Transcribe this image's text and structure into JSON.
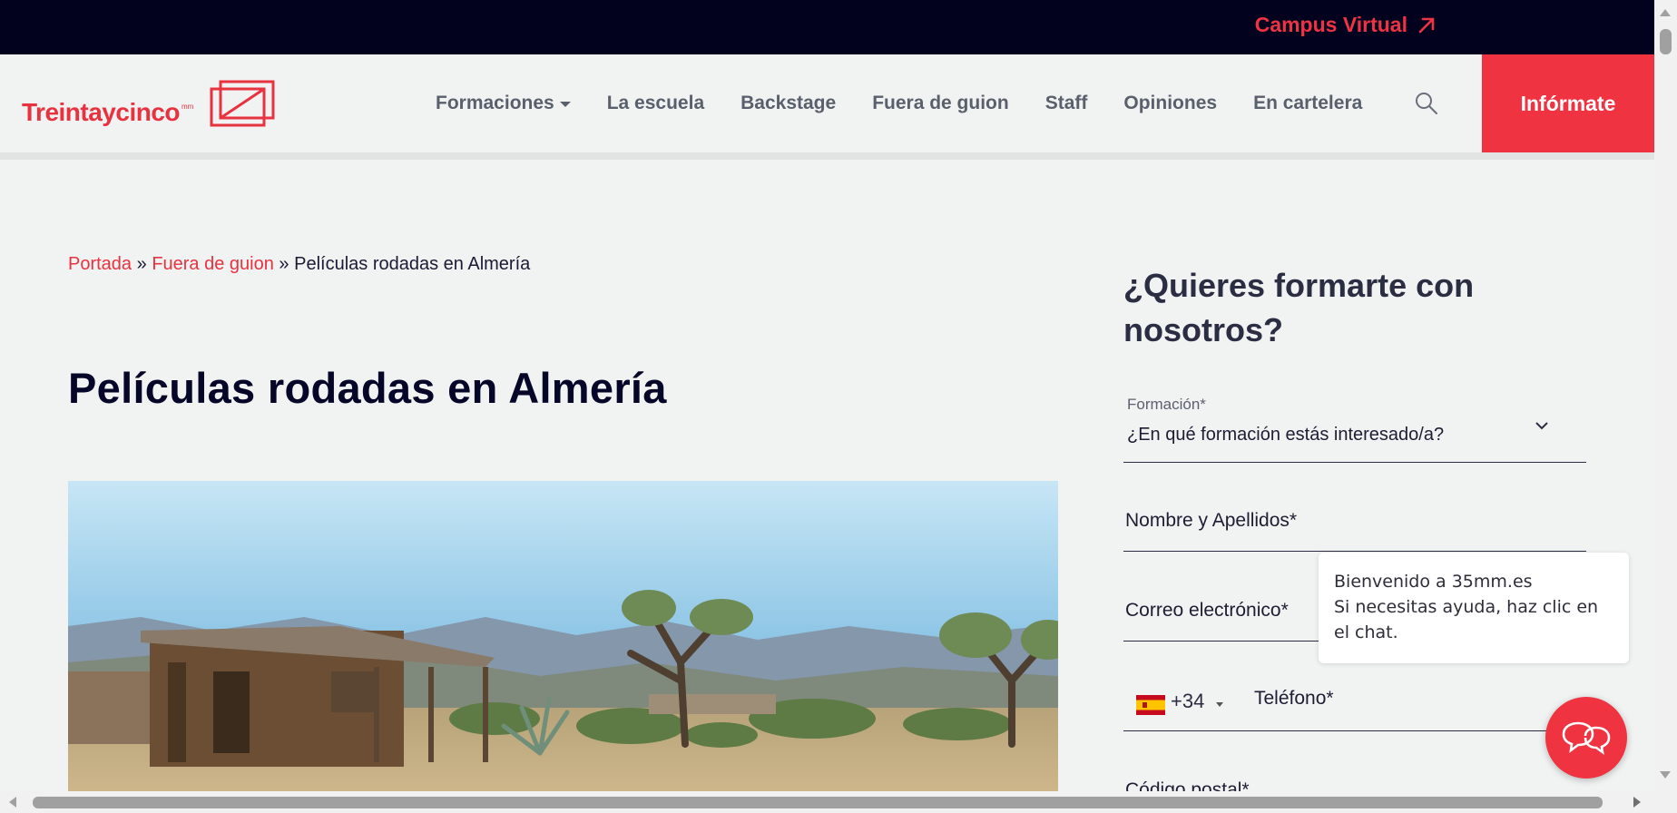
{
  "topbar": {
    "campus_label": "Campus Virtual"
  },
  "brand": {
    "name": "Treintaycinco",
    "mm": "mm",
    "accent": "#ef3340",
    "dark": "#02021f"
  },
  "nav": {
    "items": [
      "Formaciones",
      "La escuela",
      "Backstage",
      "Fuera de guion",
      "Staff",
      "Opiniones",
      "En cartelera"
    ],
    "cta": "Infórmate"
  },
  "breadcrumb": {
    "home": "Portada",
    "section": "Fuera de guion",
    "current": "Películas rodadas en Almería",
    "sep": "»"
  },
  "article": {
    "title": "Películas rodadas en Almería"
  },
  "form": {
    "title": "¿Quieres formarte con nosotros?",
    "formacion_label": "Formación*",
    "formacion_value": "¿En qué formación estás interesado/a?",
    "name_label": "Nombre y Apellidos*",
    "email_label": "Correo electrónico*",
    "dial_code": "+34",
    "phone_label": "Teléfono*",
    "postal_label": "Código postal*"
  },
  "chat": {
    "line1": "Bienvenido a 35mm.es",
    "line2": "Si necesitas ayuda, haz clic en el chat."
  }
}
